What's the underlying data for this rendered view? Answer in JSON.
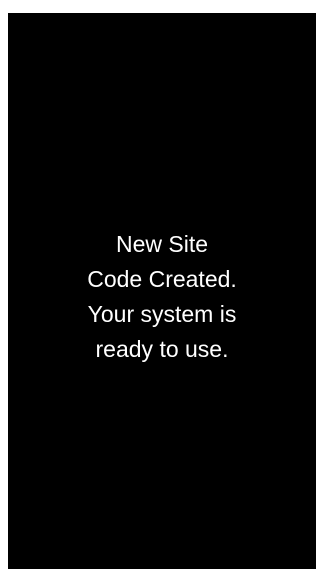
{
  "screen": {
    "background_color": "#000000",
    "text_color": "#ffffff",
    "message_lines": [
      "New Site",
      "Code Created.",
      "Your system is",
      "ready to use."
    ]
  }
}
